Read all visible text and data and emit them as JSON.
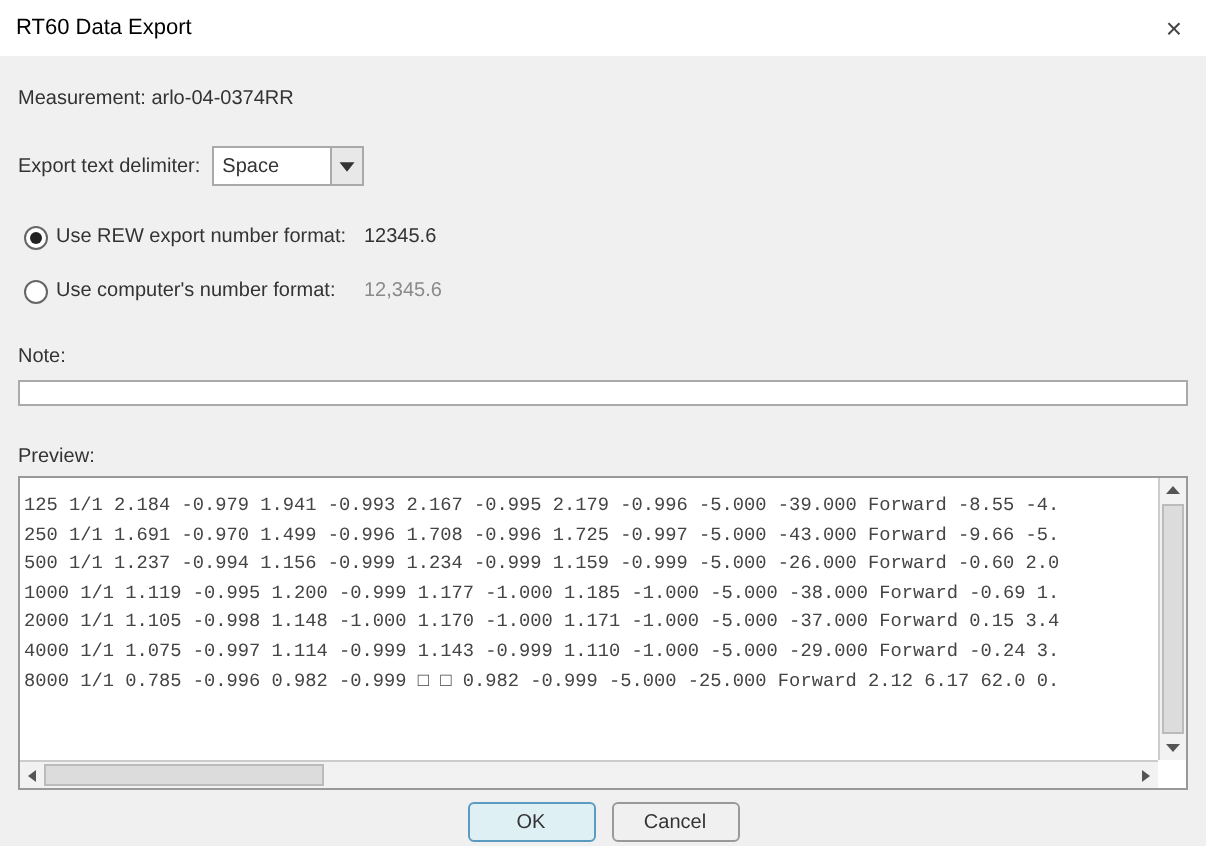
{
  "window": {
    "title": "RT60 Data Export",
    "close": "×"
  },
  "measurement": "Measurement: arlo-04-0374RR",
  "delimiter": {
    "label": "Export text delimiter:",
    "value": "Space"
  },
  "number_formats": [
    {
      "label": "Use REW export number format:",
      "example": "12345.6",
      "selected": true
    },
    {
      "label": "Use computer's number format:",
      "example": "12,345.6",
      "selected": false
    }
  ],
  "note": {
    "label": "Note:"
  },
  "preview": {
    "label": "Preview:",
    "lines": [
      "125 1/1 2.184 -0.979 1.941 -0.993 2.167 -0.995 2.179 -0.996 -5.000 -39.000 Forward -8.55 -4.",
      "250 1/1 1.691 -0.970 1.499 -0.996 1.708 -0.996 1.725 -0.997 -5.000 -43.000 Forward -9.66 -5.",
      "500 1/1 1.237 -0.994 1.156 -0.999 1.234 -0.999 1.159 -0.999 -5.000 -26.000 Forward -0.60 2.0",
      "1000 1/1 1.119 -0.995 1.200 -0.999 1.177 -1.000 1.185 -1.000 -5.000 -38.000 Forward -0.69 1.",
      "2000 1/1 1.105 -0.998 1.148 -1.000 1.170 -1.000 1.171 -1.000 -5.000 -37.000 Forward 0.15 3.4",
      "4000 1/1 1.075 -0.997 1.114 -0.999 1.143 -0.999 1.110 -1.000 -5.000 -29.000 Forward -0.24 3.",
      "8000 1/1 0.785 -0.996 0.982 -0.999 □ □ 0.982 -0.999 -5.000 -25.000 Forward 2.12 6.17 62.0 0."
    ]
  },
  "buttons": [
    {
      "label": "OK",
      "kind": "default"
    },
    {
      "label": "Cancel",
      "kind": "normal"
    }
  ]
}
